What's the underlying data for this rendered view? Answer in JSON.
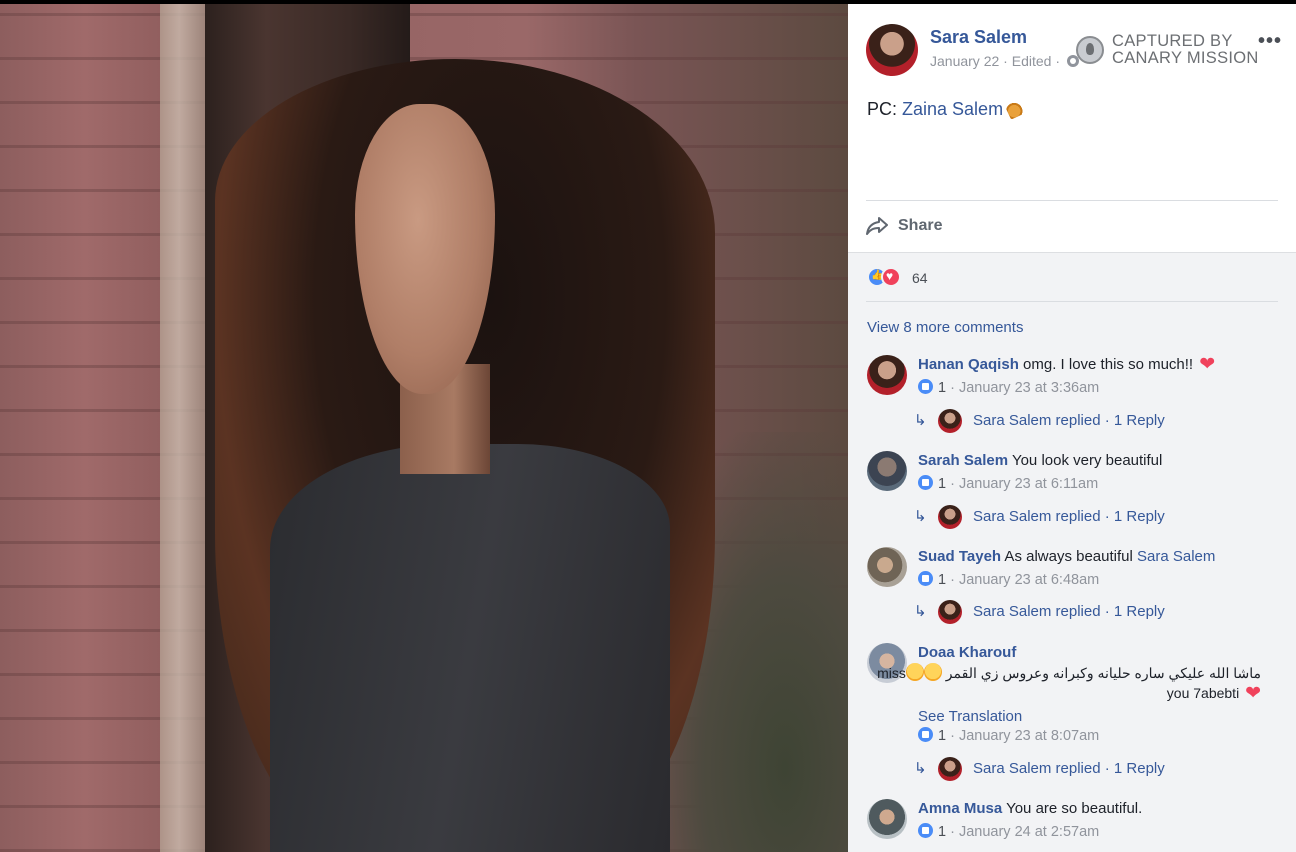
{
  "watermark": {
    "line1": "CAPTURED BY",
    "line2": "CANARY MISSION"
  },
  "post": {
    "author": "Sara Salem",
    "date": "January 22",
    "edited": "Edited",
    "text_prefix": "PC: ",
    "text_mention": "Zaina Salem",
    "more_icon": "•••",
    "share_label": "Share",
    "reaction_count": "64",
    "view_more": "View 8 more comments"
  },
  "comments": [
    {
      "name": "Hanan Qaqish",
      "text": " omg. I love this so much!!",
      "heart": "❤",
      "likes": "1",
      "time": "January 23 at 3:36am",
      "reply": "Sara Salem replied · 1 Reply"
    },
    {
      "name": "Sarah Salem",
      "text": " You look very beautiful",
      "likes": "1",
      "time": "January 23 at 6:11am",
      "reply": "Sara Salem replied · 1 Reply"
    },
    {
      "name": "Suad Tayeh",
      "text": " As always beautiful ",
      "mention": "Sara Salem",
      "likes": "1",
      "time": "January 23 at 6:48am",
      "reply": "Sara Salem replied · 1 Reply"
    },
    {
      "name": "Doaa Kharouf",
      "arabic": "ماشا الله عليكي ساره حليانه وكبرانه وعروس زي القمر",
      "miss": "miss",
      "line2": " you 7abebti",
      "heart": "❤",
      "see_translation": "See Translation",
      "likes": "1",
      "time": "January 23 at 8:07am",
      "reply": "Sara Salem replied · 1 Reply"
    },
    {
      "name": "Amna Musa",
      "text": " You are so beautiful.",
      "likes": "1",
      "time": "January 24 at 2:57am"
    }
  ],
  "meta_sep": " · "
}
